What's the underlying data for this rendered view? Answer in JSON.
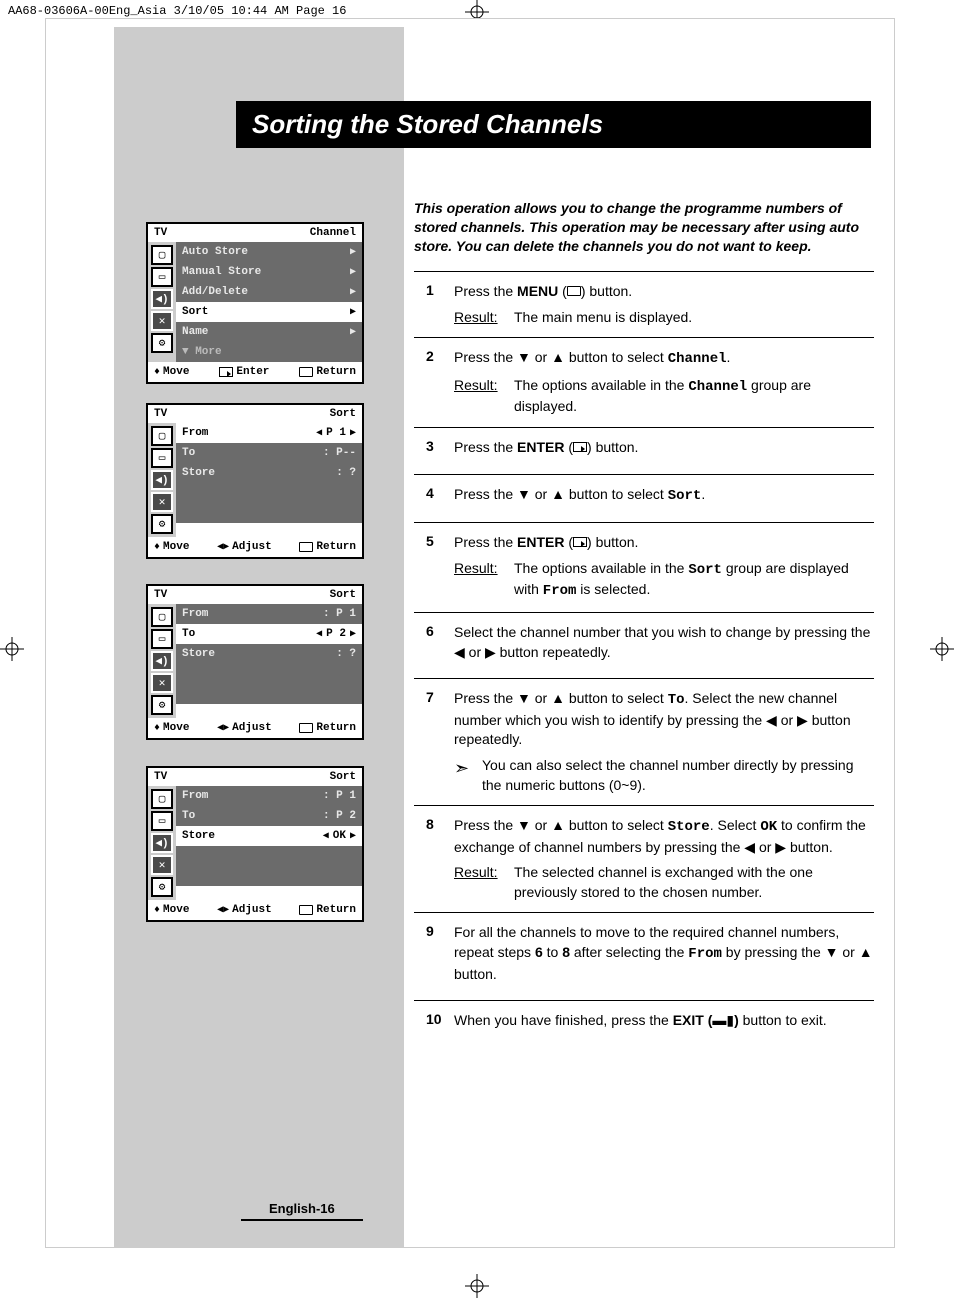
{
  "slug": "AA68-03606A-00Eng_Asia  3/10/05  10:44 AM  Page 16",
  "title": "Sorting the Stored Channels",
  "intro": "This operation allows you to change the programme numbers of stored channels. This operation may be necessary after using auto store. You can delete the channels you do not want to keep.",
  "page_number": "English-16",
  "result_label": "Result:",
  "steps": {
    "s1": {
      "num": "1",
      "p1a": "Press the ",
      "p1b": "MENU",
      "p1c": " (",
      "p1d": ") button.",
      "r": "The main menu is displayed."
    },
    "s2": {
      "num": "2",
      "p1a": "Press the ▼ or ▲ button to select ",
      "p1b": "Channel",
      "p1c": ".",
      "r1": "The options available in the ",
      "r2": "Channel",
      "r3": " group are displayed."
    },
    "s3": {
      "num": "3",
      "p1a": "Press the ",
      "p1b": "ENTER",
      "p1c": " (",
      "p1d": ") button."
    },
    "s4": {
      "num": "4",
      "p1a": "Press the ▼ or ▲ button to select ",
      "p1b": "Sort",
      "p1c": "."
    },
    "s5": {
      "num": "5",
      "p1a": "Press the ",
      "p1b": "ENTER",
      "p1c": " (",
      "p1d": ") button.",
      "r1": "The options available in the ",
      "r2": "Sort",
      "r3": " group are displayed with ",
      "r4": "From",
      "r5": " is selected."
    },
    "s6": {
      "num": "6",
      "p": "Select the channel number that you wish to change by pressing the ◀ or ▶ button repeatedly."
    },
    "s7": {
      "num": "7",
      "p1a": "Press the ▼ or ▲ button to select ",
      "p1b": "To",
      "p1c": ". Select the new channel number which you wish to identify by pressing the ◀ or ▶ button repeatedly.",
      "note": "You can also select the channel number directly by pressing the numeric buttons (0~9)."
    },
    "s8": {
      "num": "8",
      "p1a": "Press the ▼ or ▲ button to select ",
      "p1b": "Store",
      "p1c": ". Select ",
      "p1d": "OK",
      "p1e": " to confirm the exchange of channel numbers by pressing the ◀ or ▶ button.",
      "r": "The selected channel is exchanged with the one previously stored to the chosen number."
    },
    "s9": {
      "num": "9",
      "p1a": "For all the channels to move to the required channel numbers, repeat steps ",
      "p1b": "6",
      "p1c": " to ",
      "p1d": "8",
      "p1e": " after selecting the ",
      "p1f": "From",
      "p1g": " by pressing the ▼ or ▲ button."
    },
    "s10": {
      "num": "10",
      "p1a": "When you have finished, press the ",
      "p1b": "EXIT (",
      "p1c": ")",
      "p1d": " button to exit."
    }
  },
  "osd": {
    "tv_label": "TV",
    "foot_move": "Move",
    "foot_enter": "Enter",
    "foot_adjust": "Adjust",
    "foot_return": "Return",
    "menu1": {
      "head_right": "Channel",
      "rows": [
        "Auto Store",
        "Manual Store",
        "Add/Delete",
        "Sort",
        "Name",
        "▼ More"
      ]
    },
    "menu2": {
      "head_right": "Sort",
      "r1l": "From",
      "r1r": "P 1",
      "r2l": "To",
      "r2r": ": P--",
      "r3l": "Store",
      "r3r": ": ?"
    },
    "menu3": {
      "head_right": "Sort",
      "r1l": "From",
      "r1r": ": P 1",
      "r2l": "To",
      "r2r": "P 2",
      "r3l": "Store",
      "r3r": ": ?"
    },
    "menu4": {
      "head_right": "Sort",
      "r1l": "From",
      "r1r": ": P 1",
      "r2l": "To",
      "r2r": ": P 2",
      "r3l": "Store",
      "r3r": "OK"
    }
  }
}
